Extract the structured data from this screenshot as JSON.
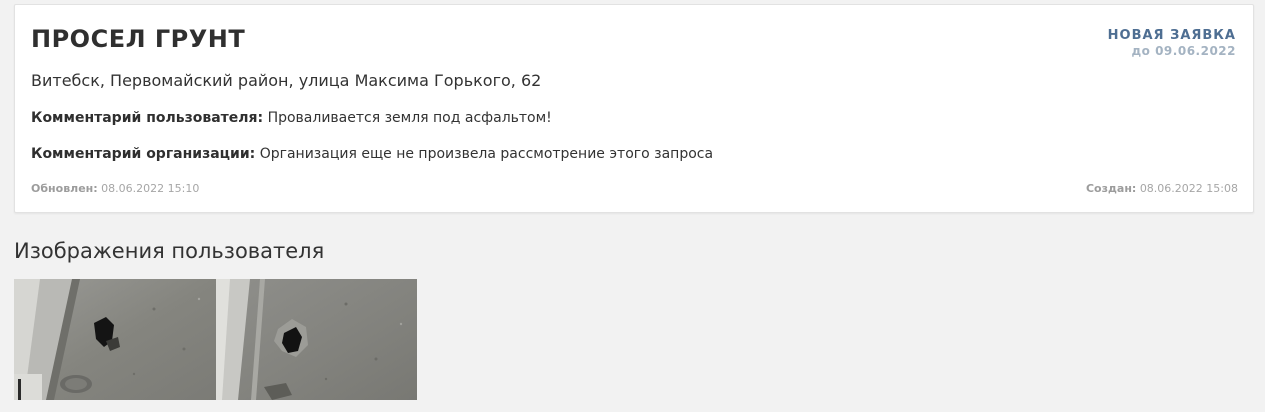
{
  "request": {
    "title": "ПРОСЕЛ ГРУНТ",
    "status": "НОВАЯ ЗАЯВКА",
    "deadline": "до 09.06.2022",
    "address": "Витебск, Первомайский район, улица Максима Горького, 62",
    "user_comment_label": "Комментарий пользователя:",
    "user_comment": "Проваливается земля под асфальтом!",
    "org_comment_label": "Комментарий организации:",
    "org_comment": "Организация еще не произвела рассмотрение этого запроса",
    "updated_label": "Обновлен:",
    "updated_value": "08.06.2022 15:10",
    "created_label": "Создан:",
    "created_value": "08.06.2022 15:08"
  },
  "gallery": {
    "title": "Изображения пользователя"
  },
  "colors": {
    "page_background": "#f2f2f2",
    "card_background": "#ffffff",
    "status_accent": "#4e6e92",
    "deadline": "#a4b3c2",
    "meta_text": "#a6a6a6"
  }
}
